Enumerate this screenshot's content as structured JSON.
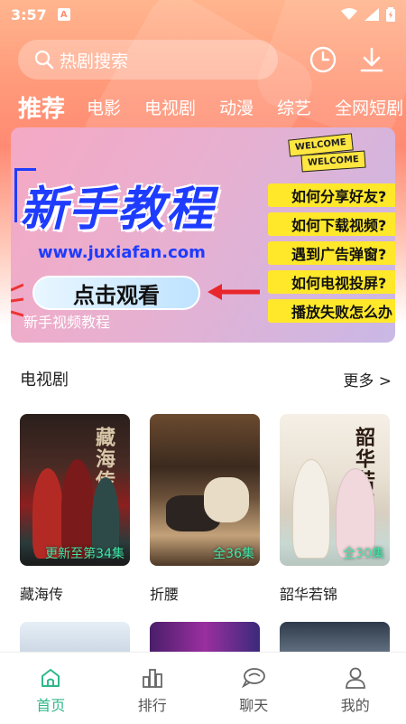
{
  "status": {
    "time": "3:57",
    "notif_letter": "A"
  },
  "search": {
    "placeholder": "热剧搜索"
  },
  "tabs": [
    {
      "label": "推荐",
      "active": true
    },
    {
      "label": "电影"
    },
    {
      "label": "电视剧"
    },
    {
      "label": "动漫"
    },
    {
      "label": "综艺"
    },
    {
      "label": "全网短剧"
    }
  ],
  "banner": {
    "welcome1": "WELCOME",
    "welcome2": "WELCOME",
    "title": "新手教程",
    "url": "www.juxiafan.com",
    "cta": "点击观看",
    "subtitle": "新手视频教程",
    "questions": [
      "如何分享好友?",
      "如何下载视频?",
      "遇到广告弹窗?",
      "如何电视投屏?",
      "播放失败怎么办"
    ]
  },
  "section": {
    "title": "电视剧",
    "more": "更多 >"
  },
  "cards": [
    {
      "name": "藏海传",
      "episode": "更新至第34集",
      "poster_text": "藏海传"
    },
    {
      "name": "折腰",
      "episode": "全36集",
      "poster_text": ""
    },
    {
      "name": "韶华若锦",
      "episode": "全30集",
      "poster_text": "韶华若锦"
    }
  ],
  "nav": [
    {
      "label": "首页",
      "icon": "home-icon",
      "active": true
    },
    {
      "label": "排行",
      "icon": "ranking-icon"
    },
    {
      "label": "聊天",
      "icon": "chat-icon"
    },
    {
      "label": "我的",
      "icon": "profile-icon"
    }
  ],
  "colors": {
    "accent": "#2fb88a",
    "header_gradient": "#ff9a7a",
    "episode_text": "#41e6a8"
  }
}
